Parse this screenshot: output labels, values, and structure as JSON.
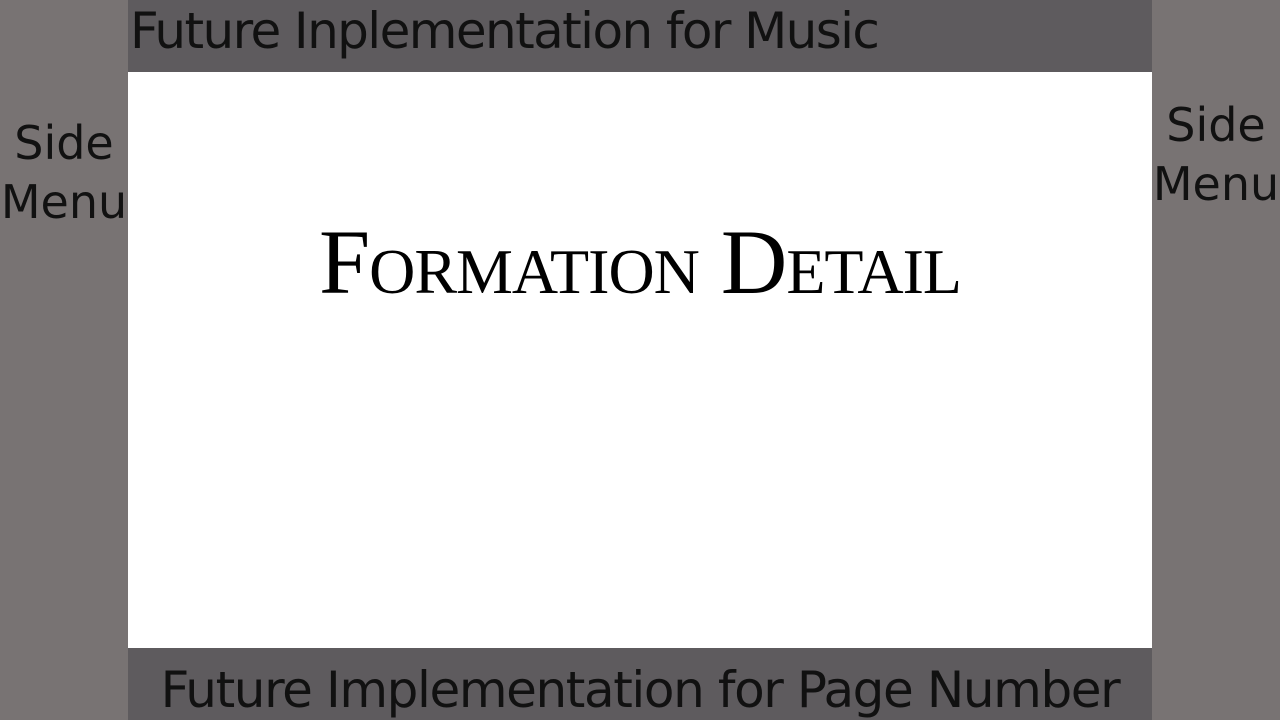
{
  "header": {
    "music_text": "Future Inplementation for Music"
  },
  "footer": {
    "page_number_text": "Future Implementation for Page Number"
  },
  "left_menu": {
    "label": "SideMenu"
  },
  "right_menu": {
    "label": "SideMenu"
  },
  "main": {
    "title": "Formation Detail"
  },
  "colors": {
    "side_panel": "#787373",
    "bar": "#5e5b5e",
    "content_background": "#ffffff",
    "text": "#111111"
  }
}
